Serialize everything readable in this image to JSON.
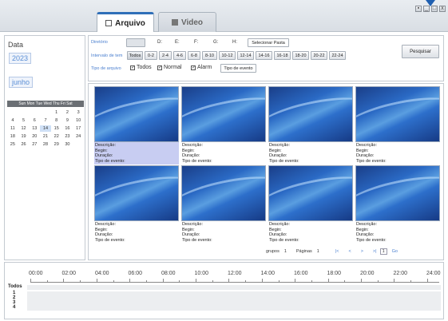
{
  "tabs": [
    {
      "label": "Arquivo",
      "icon": "document-icon"
    },
    {
      "label": "Video",
      "icon": "video-icon"
    }
  ],
  "window_buttons": [
    "▪",
    "_",
    "□",
    "x"
  ],
  "sidebar": {
    "data_label": "Data",
    "year": "2023",
    "month": "junho",
    "weekday_header": "Sun Mon Tue Wed Thu  Fri  Sat",
    "days": [
      "",
      "",
      "",
      "",
      "1",
      "2",
      "3",
      "4",
      "5",
      "6",
      "7",
      "8",
      "9",
      "10",
      "11",
      "12",
      "13",
      "14",
      "15",
      "16",
      "17",
      "18",
      "19",
      "20",
      "21",
      "22",
      "23",
      "24",
      "25",
      "26",
      "27",
      "28",
      "29",
      "30",
      ""
    ],
    "selected_day": "14"
  },
  "filters": {
    "directory_label": "Diretório",
    "drives": [
      "D:",
      "E:",
      "F:",
      "G:",
      "H:"
    ],
    "select_folder": "Selecionar Pasta",
    "interval_label": "Intervalo de tem",
    "intervals": [
      "Todos",
      "0-2",
      "2-4",
      "4-6",
      "6-8",
      "8-10",
      "10-12",
      "12-14",
      "14-16",
      "16-18",
      "18-20",
      "20-22",
      "22-24"
    ],
    "file_type_label": "Tipo de arquivo",
    "types": [
      {
        "label": "Todos",
        "checked": true
      },
      {
        "label": "Normal",
        "checked": true
      },
      {
        "label": "Alarm",
        "checked": true
      }
    ],
    "event_type_button": "Tipo de evento",
    "search_button": "Pesquisar"
  },
  "results": {
    "card_fields": [
      "Descrição:",
      "Begin:",
      "Duração:",
      "Tipo de evento:"
    ],
    "count": 8,
    "selected_index": 0,
    "groups_label": "grupos",
    "groups_value": "1",
    "pages_label": "Páginas",
    "pages_value": "1",
    "nav": [
      "|<",
      "<",
      ">",
      ">|"
    ],
    "page_input": "1",
    "go_label": "Go"
  },
  "timeline": {
    "hours": [
      "00:00",
      "02:00",
      "04:00",
      "06:00",
      "08:00",
      "10:00",
      "12:00",
      "14:00",
      "16:00",
      "18:00",
      "20:00",
      "22:00",
      "24:00"
    ],
    "rows": [
      "Todos",
      "1",
      "2",
      "3",
      "4"
    ]
  },
  "colors": {
    "accent": "#2f6fb8",
    "label_blue": "#4a7fcf",
    "selection": "#c8cdf2"
  }
}
